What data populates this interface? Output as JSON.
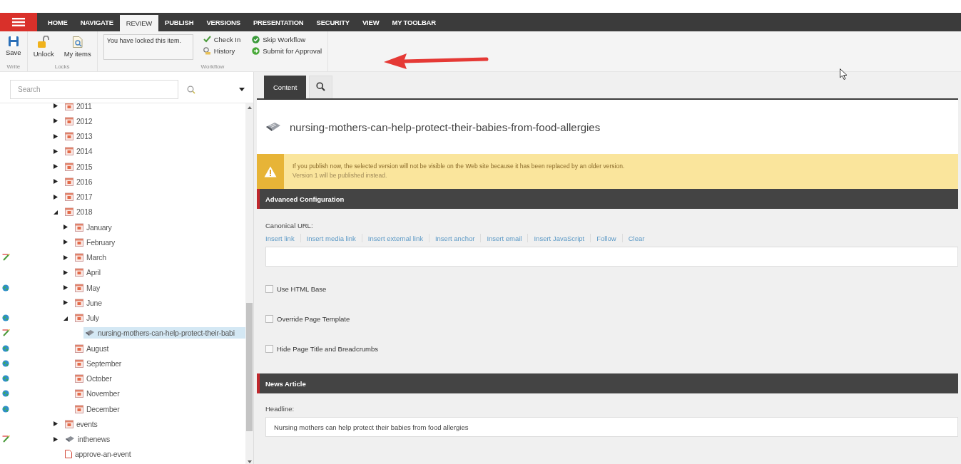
{
  "tabs": [
    {
      "label": "HOME",
      "selected": false
    },
    {
      "label": "NAVIGATE",
      "selected": false
    },
    {
      "label": "REVIEW",
      "selected": true
    },
    {
      "label": "PUBLISH",
      "selected": false
    },
    {
      "label": "VERSIONS",
      "selected": false
    },
    {
      "label": "PRESENTATION",
      "selected": false
    },
    {
      "label": "SECURITY",
      "selected": false
    },
    {
      "label": "VIEW",
      "selected": false
    },
    {
      "label": "MY TOOLBAR",
      "selected": false
    }
  ],
  "ribbon": {
    "groups": [
      {
        "label": "Write",
        "buttons": [
          {
            "label": "Save",
            "kind": "save"
          }
        ]
      },
      {
        "label": "Locks",
        "buttons": [
          {
            "label": "Unlock",
            "kind": "unlock"
          },
          {
            "label": "My items",
            "kind": "items"
          }
        ]
      },
      {
        "label": "Workflow",
        "message": "You have locked this item.",
        "commands": [
          {
            "label": "Check In",
            "kind": "checkin"
          },
          {
            "label": "History",
            "kind": "history"
          },
          {
            "label": "Skip Workflow",
            "kind": "skip"
          },
          {
            "label": "Submit for Approval",
            "kind": "submit"
          }
        ]
      }
    ]
  },
  "search": {
    "placeholder": "Search"
  },
  "tree": {
    "items": [
      {
        "children": [
          {
            "label": "2011",
            "kind": "calendar",
            "expanded": false,
            "selected": false,
            "published": false,
            "edited": false
          },
          {
            "label": "2012",
            "kind": "calendar",
            "expanded": false,
            "selected": false,
            "published": false,
            "edited": false
          },
          {
            "label": "2013",
            "kind": "calendar",
            "expanded": false,
            "selected": false,
            "published": false,
            "edited": false
          },
          {
            "label": "2014",
            "kind": "calendar",
            "expanded": false,
            "selected": false,
            "published": false,
            "edited": false
          },
          {
            "label": "2015",
            "kind": "calendar",
            "expanded": false,
            "selected": false,
            "published": false,
            "edited": false
          },
          {
            "label": "2016",
            "kind": "calendar",
            "expanded": false,
            "selected": false,
            "published": false,
            "edited": false
          },
          {
            "label": "2017",
            "kind": "calendar",
            "expanded": false,
            "selected": false,
            "published": false,
            "edited": false
          },
          {
            "label": "2018",
            "kind": "calendar",
            "expanded": true,
            "selected": false,
            "published": false,
            "edited": false,
            "children": [
              {
                "label": "January",
                "kind": "calendar",
                "expanded": false,
                "selected": false,
                "published": false,
                "edited": false
              },
              {
                "label": "February",
                "kind": "calendar",
                "expanded": false,
                "selected": false,
                "published": false,
                "edited": false
              },
              {
                "label": "March",
                "kind": "calendar",
                "expanded": false,
                "selected": false,
                "published": false,
                "edited": true
              },
              {
                "label": "April",
                "kind": "calendar",
                "expanded": false,
                "selected": false,
                "published": false,
                "edited": false
              },
              {
                "label": "May",
                "kind": "calendar",
                "expanded": false,
                "selected": false,
                "published": true,
                "edited": false
              },
              {
                "label": "June",
                "kind": "calendar",
                "expanded": false,
                "selected": false,
                "published": false,
                "edited": false
              },
              {
                "label": "July",
                "kind": "calendar",
                "expanded": true,
                "selected": false,
                "published": true,
                "edited": false,
                "children": [
                  {
                    "label": "nursing-mothers-can-help-protect-their-babi",
                    "kind": "article",
                    "selected": true,
                    "published": false,
                    "edited": true
                  }
                ]
              },
              {
                "label": "August",
                "kind": "calendar",
                "selected": false,
                "published": true,
                "edited": false
              },
              {
                "label": "September",
                "kind": "calendar",
                "selected": false,
                "published": true,
                "edited": false
              },
              {
                "label": "October",
                "kind": "calendar",
                "selected": false,
                "published": true,
                "edited": false
              },
              {
                "label": "November",
                "kind": "calendar",
                "selected": false,
                "published": true,
                "edited": false
              },
              {
                "label": "December",
                "kind": "calendar",
                "selected": false,
                "published": true,
                "edited": false
              }
            ]
          }
        ]
      },
      {
        "label": "events",
        "kind": "calendar",
        "expanded": false,
        "selected": false,
        "published": false,
        "edited": false
      },
      {
        "label": "inthenews",
        "kind": "article",
        "expanded": false,
        "selected": false,
        "published": false,
        "edited": true
      },
      {
        "label": "approve-an-event",
        "kind": "page",
        "selected": false,
        "published": false,
        "edited": false
      }
    ]
  },
  "editor_tabs": [
    {
      "kind": "text",
      "label": "Content",
      "selected": true
    },
    {
      "kind": "search",
      "selected": false
    }
  ],
  "item_title": "nursing-mothers-can-help-protect-their-babies-from-food-allergies",
  "warning": {
    "lines": [
      "If you publish now, the selected version will not be visible on the Web site because it has been replaced by an older version.",
      "Version 1 will be published instead."
    ]
  },
  "sections": [
    {
      "title": "Advanced Configuration",
      "fields": [
        {
          "kind": "link",
          "label": "Canonical URL:",
          "actions": [
            "Insert link",
            "Insert media link",
            "Insert external link",
            "Insert anchor",
            "Insert email",
            "Insert JavaScript",
            "Follow",
            "Clear"
          ]
        },
        {
          "kind": "checkbox",
          "label": "Use HTML Base",
          "checked": false
        },
        {
          "kind": "checkbox",
          "label": "Override Page Template",
          "checked": false
        },
        {
          "kind": "checkbox",
          "label": "Hide Page Title and Breadcrumbs",
          "checked": false
        }
      ]
    },
    {
      "title": "News Article",
      "fields": [
        {
          "kind": "text",
          "label": "Headline:",
          "value": "Nursing mothers can help protect their babies from food allergies"
        }
      ]
    }
  ]
}
